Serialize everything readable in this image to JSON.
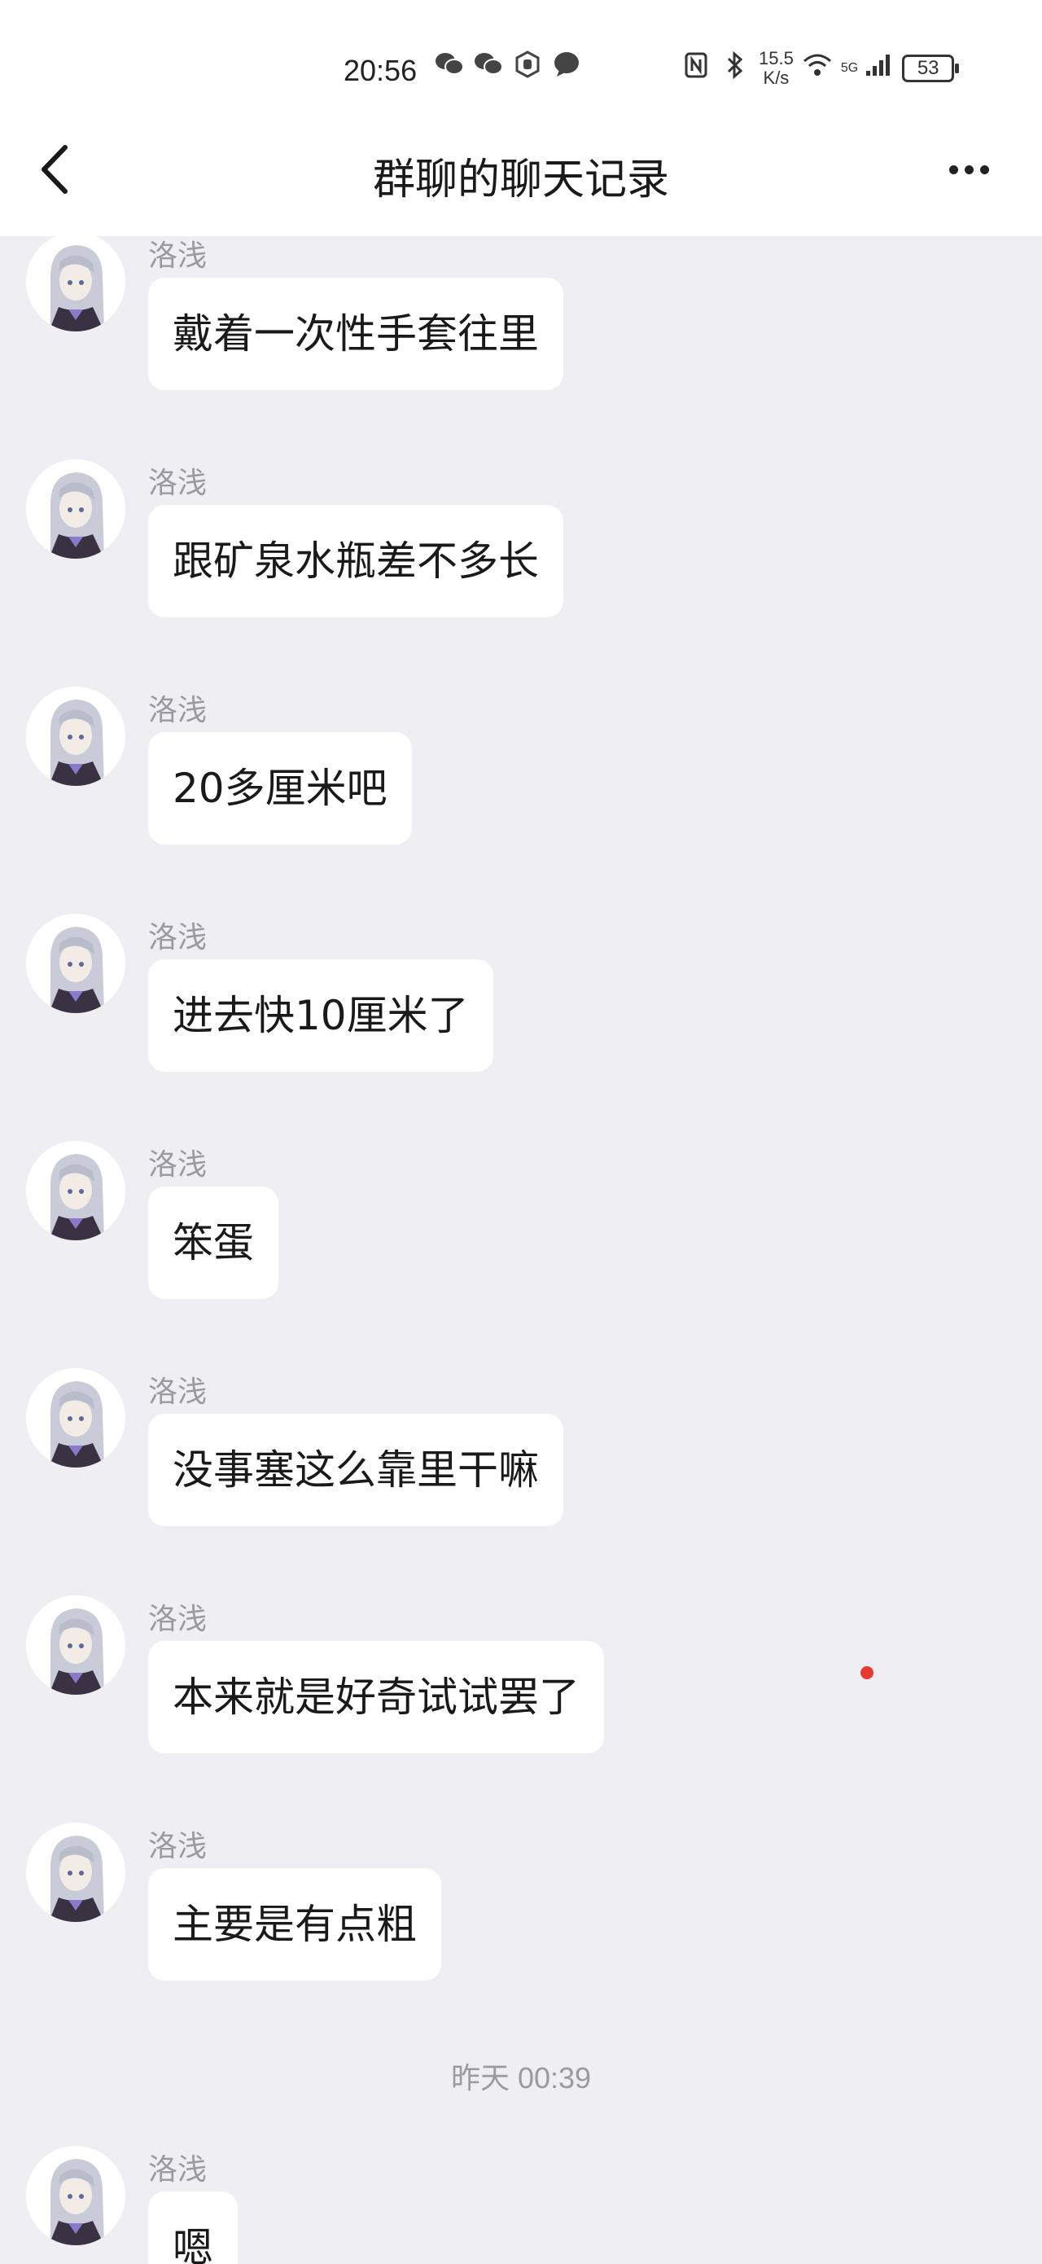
{
  "status_bar": {
    "time": "20:56",
    "net_speed_value": "15.5",
    "net_speed_unit": "K/s",
    "signal_label": "5G",
    "battery": "53"
  },
  "header": {
    "title": "群聊的聊天记录"
  },
  "messages": [
    {
      "sender": "洛浅",
      "text": "戴着一次性手套往里"
    },
    {
      "sender": "洛浅",
      "text": "跟矿泉水瓶差不多长"
    },
    {
      "sender": "洛浅",
      "text": "20多厘米吧"
    },
    {
      "sender": "洛浅",
      "text": "进去快10厘米了"
    },
    {
      "sender": "洛浅",
      "text": "笨蛋"
    },
    {
      "sender": "洛浅",
      "text": "没事塞这么靠里干嘛"
    },
    {
      "sender": "洛浅",
      "text": "本来就是好奇试试罢了"
    },
    {
      "sender": "洛浅",
      "text": "主要是有点粗"
    }
  ],
  "timestamp": "昨天 00:39",
  "last_message": {
    "sender": "洛浅",
    "text": "嗯"
  },
  "colors": {
    "background": "#eeeef3",
    "bubble": "#ffffff",
    "secondary_text": "#9a9aa2",
    "notification_dot": "#e63a2e"
  }
}
